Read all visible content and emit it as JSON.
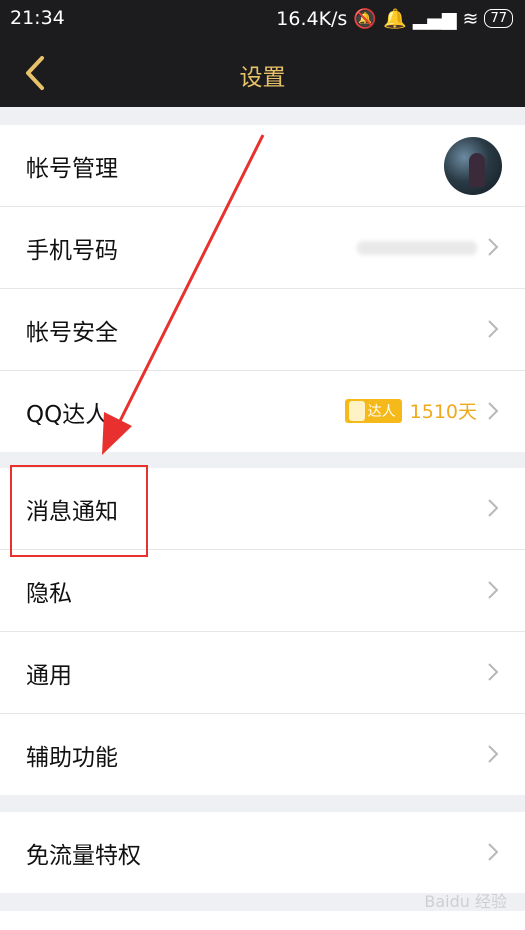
{
  "status_bar": {
    "time": "21:34",
    "speed": "16.4K/s",
    "battery": "77"
  },
  "nav": {
    "title": "设置"
  },
  "group1": [
    {
      "label": "帐号管理"
    },
    {
      "label": "手机号码"
    },
    {
      "label": "帐号安全"
    },
    {
      "label": "QQ达人",
      "badge": "达人",
      "days": "1510天"
    }
  ],
  "group2": [
    {
      "label": "消息通知"
    },
    {
      "label": "隐私"
    },
    {
      "label": "通用"
    },
    {
      "label": "辅助功能"
    }
  ],
  "group3": [
    {
      "label": "免流量特权"
    }
  ],
  "watermark": "Baidu 经验",
  "colors": {
    "accent": "#e8c26a",
    "annotation": "#e8302f",
    "badge": "#f6b91a"
  }
}
